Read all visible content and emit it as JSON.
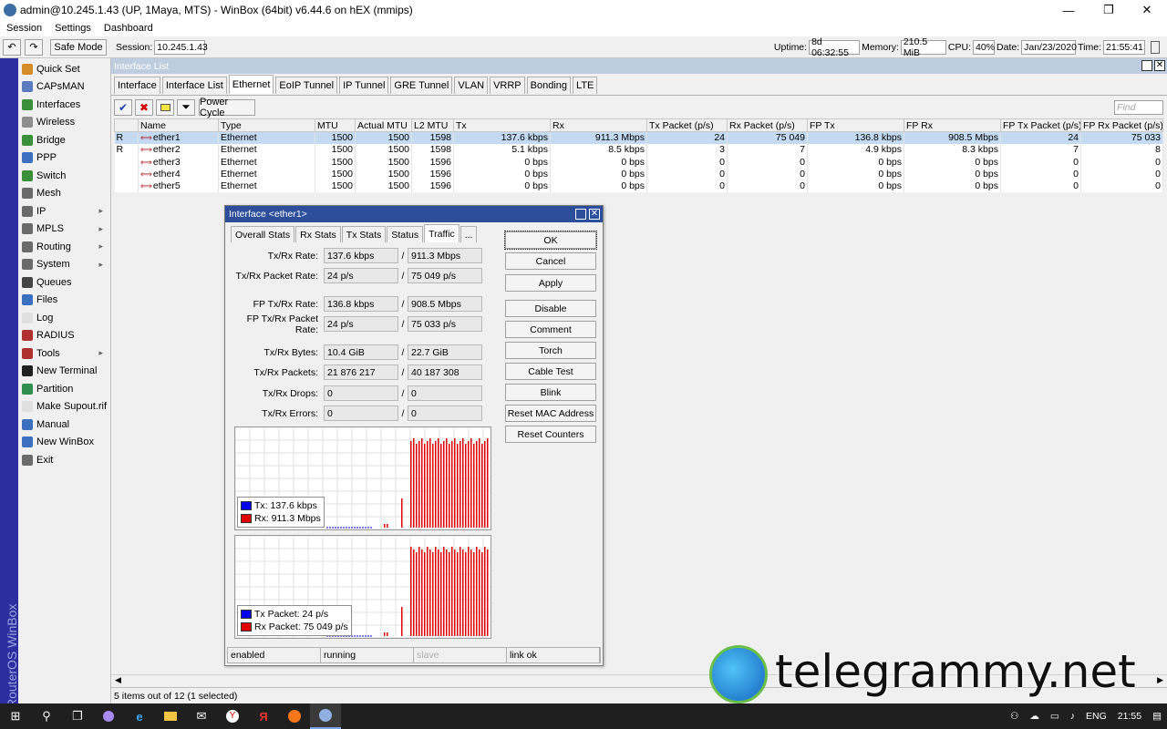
{
  "window": {
    "title": "admin@10.245.1.43 (UP, 1Maya, MTS) - WinBox (64bit) v6.44.6 on hEX (mmips)",
    "minimize": "—",
    "restore": "❐",
    "close": "✕"
  },
  "menu": [
    "Session",
    "Settings",
    "Dashboard"
  ],
  "toolbar": {
    "undo": "↶",
    "redo": "↷",
    "safe_mode": "Safe Mode",
    "session_label": "Session:",
    "session_value": "10.245.1.43",
    "uptime_label": "Uptime:",
    "uptime_value": "8d 06:32:55",
    "memory_label": "Memory:",
    "memory_value": "210.5 MiB",
    "cpu_label": "CPU:",
    "cpu_value": "40%",
    "date_label": "Date:",
    "date_value": "Jan/23/2020",
    "time_label": "Time:",
    "time_value": "21:55:41"
  },
  "side_text": "RouterOS WinBox",
  "sidebar": [
    {
      "label": "Quick Set",
      "color": "#d48b2a",
      "arrow": false
    },
    {
      "label": "CAPsMAN",
      "color": "#5a7bbf",
      "arrow": false
    },
    {
      "label": "Interfaces",
      "color": "#3b8f3b",
      "arrow": false
    },
    {
      "label": "Wireless",
      "color": "#8e8e8e",
      "arrow": false
    },
    {
      "label": "Bridge",
      "color": "#3b8f3b",
      "arrow": false
    },
    {
      "label": "PPP",
      "color": "#3b6fbf",
      "arrow": false
    },
    {
      "label": "Switch",
      "color": "#3b8f3b",
      "arrow": false
    },
    {
      "label": "Mesh",
      "color": "#6a6a6a",
      "arrow": false
    },
    {
      "label": "IP",
      "color": "#6a6a6a",
      "arrow": true
    },
    {
      "label": "MPLS",
      "color": "#6a6a6a",
      "arrow": true
    },
    {
      "label": "Routing",
      "color": "#6a6a6a",
      "arrow": true
    },
    {
      "label": "System",
      "color": "#6a6a6a",
      "arrow": true
    },
    {
      "label": "Queues",
      "color": "#444444",
      "arrow": false
    },
    {
      "label": "Files",
      "color": "#3b6fbf",
      "arrow": false
    },
    {
      "label": "Log",
      "color": "#e0e0e0",
      "arrow": false
    },
    {
      "label": "RADIUS",
      "color": "#b03030",
      "arrow": false
    },
    {
      "label": "Tools",
      "color": "#b03030",
      "arrow": true
    },
    {
      "label": "New Terminal",
      "color": "#202020",
      "arrow": false
    },
    {
      "label": "Partition",
      "color": "#2e8f4e",
      "arrow": false
    },
    {
      "label": "Make Supout.rif",
      "color": "#e0e0e0",
      "arrow": false
    },
    {
      "label": "Manual",
      "color": "#3b6fbf",
      "arrow": false
    },
    {
      "label": "New WinBox",
      "color": "#3b6fbf",
      "arrow": false
    },
    {
      "label": "Exit",
      "color": "#6a6a6a",
      "arrow": false
    }
  ],
  "iflist": {
    "title": "Interface List",
    "tabs": [
      "Interface",
      "Interface List",
      "Ethernet",
      "EoIP Tunnel",
      "IP Tunnel",
      "GRE Tunnel",
      "VLAN",
      "VRRP",
      "Bonding",
      "LTE"
    ],
    "active_tab": "Ethernet",
    "power_cycle": "Power Cycle",
    "find_placeholder": "Find",
    "columns": [
      "",
      "Name",
      "Type",
      "MTU",
      "Actual MTU",
      "L2 MTU",
      "Tx",
      "Rx",
      "Tx Packet (p/s)",
      "Rx Packet (p/s)",
      "FP Tx",
      "FP Rx",
      "FP Tx Packet (p/s)",
      "FP Rx Packet (p/s)"
    ],
    "rows": [
      [
        "R",
        "ether1",
        "Ethernet",
        "1500",
        "1500",
        "1598",
        "137.6 kbps",
        "911.3 Mbps",
        "24",
        "75 049",
        "136.8 kbps",
        "908.5 Mbps",
        "24",
        "75 033"
      ],
      [
        "R",
        "ether2",
        "Ethernet",
        "1500",
        "1500",
        "1598",
        "5.1 kbps",
        "8.5 kbps",
        "3",
        "7",
        "4.9 kbps",
        "8.3 kbps",
        "7",
        "8"
      ],
      [
        "",
        "ether3",
        "Ethernet",
        "1500",
        "1500",
        "1596",
        "0 bps",
        "0 bps",
        "0",
        "0",
        "0 bps",
        "0 bps",
        "0",
        "0"
      ],
      [
        "",
        "ether4",
        "Ethernet",
        "1500",
        "1500",
        "1596",
        "0 bps",
        "0 bps",
        "0",
        "0",
        "0 bps",
        "0 bps",
        "0",
        "0"
      ],
      [
        "",
        "ether5",
        "Ethernet",
        "1500",
        "1500",
        "1596",
        "0 bps",
        "0 bps",
        "0",
        "0",
        "0 bps",
        "0 bps",
        "0",
        "0"
      ]
    ],
    "status": "5 items out of 12 (1 selected)"
  },
  "dialog": {
    "title": "Interface <ether1>",
    "tabs": [
      "Overall Stats",
      "Rx Stats",
      "Tx Stats",
      "Status",
      "Traffic",
      "..."
    ],
    "active_tab": "Traffic",
    "fields": [
      {
        "label": "Tx/Rx Rate:",
        "a": "137.6 kbps",
        "b": "911.3 Mbps"
      },
      {
        "label": "Tx/Rx Packet Rate:",
        "a": "24 p/s",
        "b": "75 049 p/s"
      },
      {
        "label": "FP Tx/Rx Rate:",
        "a": "136.8 kbps",
        "b": "908.5 Mbps"
      },
      {
        "label": "FP Tx/Rx Packet Rate:",
        "a": "24 p/s",
        "b": "75 033 p/s"
      },
      {
        "label": "Tx/Rx Bytes:",
        "a": "10.4 GiB",
        "b": "22.7 GiB"
      },
      {
        "label": "Tx/Rx Packets:",
        "a": "21 876 217",
        "b": "40 187 308"
      },
      {
        "label": "Tx/Rx Drops:",
        "a": "0",
        "b": "0"
      },
      {
        "label": "Tx/Rx Errors:",
        "a": "0",
        "b": "0"
      }
    ],
    "chart1_legend": {
      "tx_label": "Tx:",
      "tx_value": "137.6 kbps",
      "rx_label": "Rx:",
      "rx_value": "911.3 Mbps"
    },
    "chart2_legend": {
      "tx_label": "Tx Packet:",
      "tx_value": "24 p/s",
      "rx_label": "Rx Packet:",
      "rx_value": "75 049 p/s"
    },
    "buttons": [
      "OK",
      "Cancel",
      "Apply",
      "Disable",
      "Comment",
      "Torch",
      "Cable Test",
      "Blink",
      "Reset MAC Address",
      "Reset Counters"
    ],
    "status": [
      "enabled",
      "running",
      "slave",
      "link ok"
    ],
    "tx_color": "#0000ee",
    "rx_color": "#e00000"
  },
  "watermark": "telegrammy.net",
  "taskbar": {
    "lang": "ENG",
    "time": "21:55"
  }
}
